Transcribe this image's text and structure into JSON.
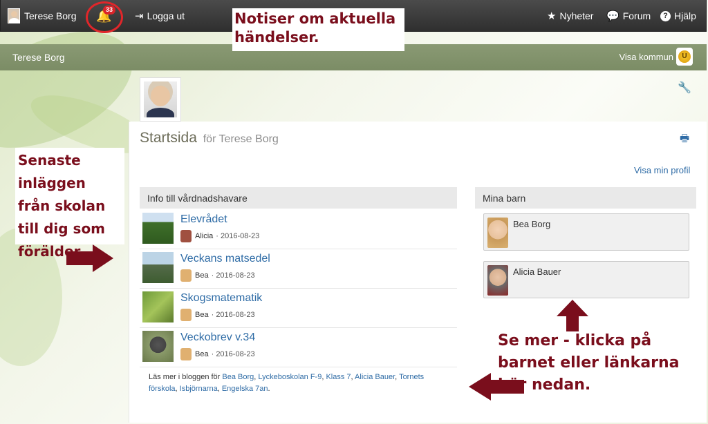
{
  "topbar": {
    "user_name": "Terese Borg",
    "notification_count": "33",
    "logout_label": "Logga ut",
    "news_label": "Nyheter",
    "forum_label": "Forum",
    "help_label": "Hjälp"
  },
  "callouts": {
    "top": "Notiser om aktuella händelser.",
    "left": "Senaste inläggen från skolan till dig som förälder.",
    "right": "Se mer - klicka på barnet eller länkarna här nedan."
  },
  "subbar": {
    "name": "Terese Borg",
    "kommun_label": "Visa kommun",
    "kommun_logo_letter": "U"
  },
  "main": {
    "title": "Startsida",
    "title_suffix": "för Terese Borg",
    "profile_link": "Visa min profil",
    "info_heading": "Info till vårdnadshavare",
    "kids_heading": "Mina barn",
    "posts": [
      {
        "title": "Elevrådet",
        "author": "Alicia",
        "date": "2016-08-23"
      },
      {
        "title": "Veckans matsedel",
        "author": "Bea",
        "date": "2016-08-23"
      },
      {
        "title": "Skogsmatematik",
        "author": "Bea",
        "date": "2016-08-23"
      },
      {
        "title": "Veckobrev v.34",
        "author": "Bea",
        "date": "2016-08-23"
      }
    ],
    "more_prefix": "Läs mer i bloggen för",
    "more_links": [
      "Bea Borg",
      "Lyckeboskolan F-9",
      "Klass 7",
      "Alicia Bauer",
      "Tornets förskola",
      "Isbjörnarna",
      "Engelska 7an"
    ],
    "kids": [
      {
        "name": "Bea Borg"
      },
      {
        "name": "Alicia Bauer"
      }
    ]
  },
  "colors": {
    "accent_link": "#2f6ca6",
    "callout_text": "#7a0e1c",
    "subbar": "#7b8c65",
    "badge": "#d9242a"
  }
}
